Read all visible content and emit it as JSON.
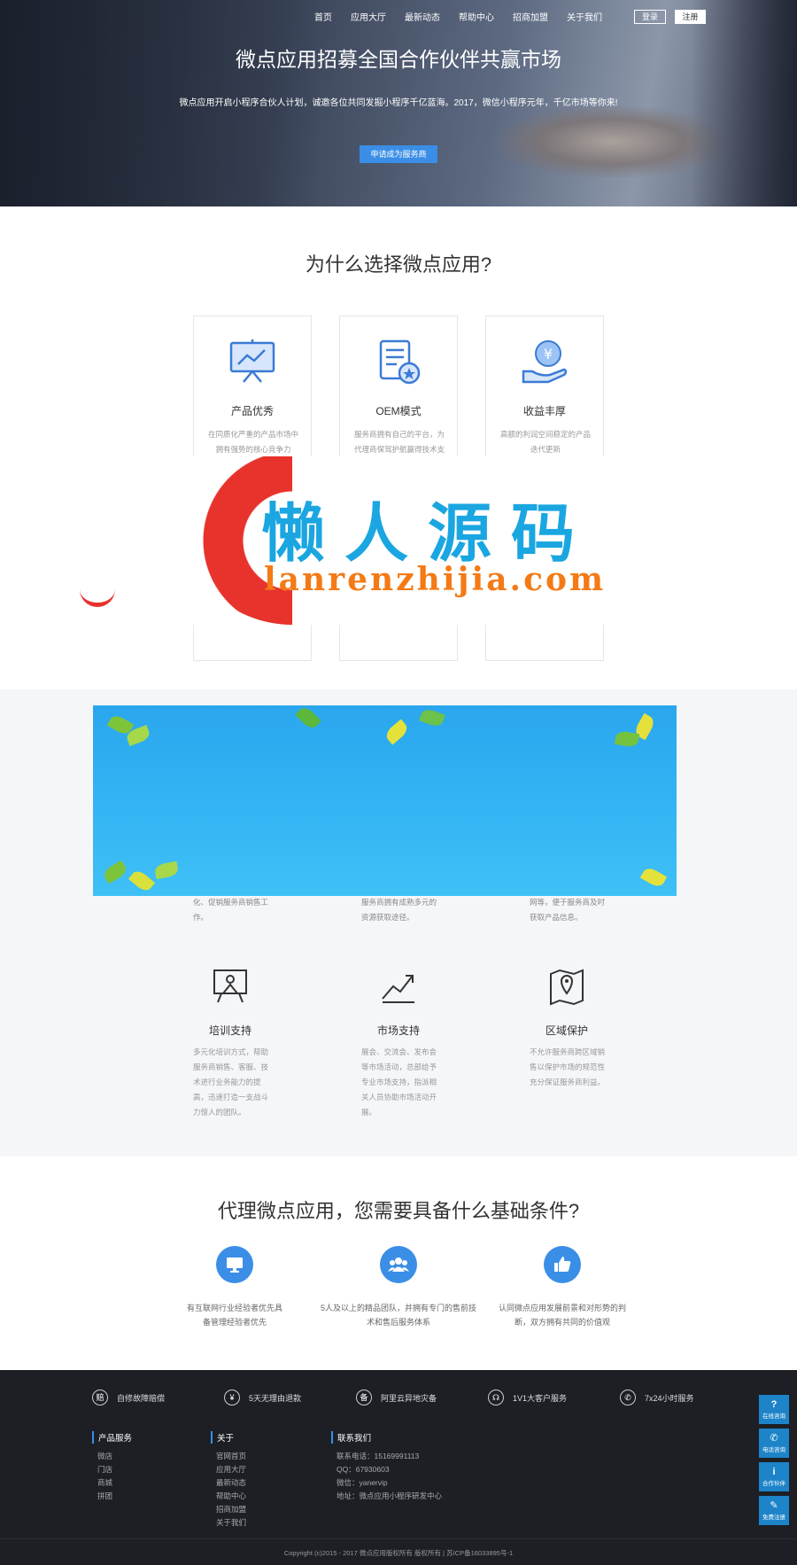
{
  "nav": {
    "items": [
      "首页",
      "应用大厅",
      "最新动态",
      "帮助中心",
      "招商加盟",
      "关于我们"
    ],
    "login": "登录",
    "register": "注册"
  },
  "hero": {
    "title": "微点应用招募全国合作伙伴共赢市场",
    "subtitle": "微点应用开启小程序合伙人计划，诚邀各位共同发掘小程序千亿蓝海。2017，微信小程序元年，千亿市场等你来!",
    "cta": "申请成为服务商"
  },
  "why": {
    "title": "为什么选择微点应用?",
    "cards": [
      {
        "icon": "presentation-chart-icon",
        "title": "产品优秀",
        "desc": "在同质化严重的产品市场中拥有强势的核心竞争力"
      },
      {
        "icon": "document-badge-icon",
        "title": "OEM模式",
        "desc": "服务商拥有自己的平台，为代理商保驾护航赢得技术支撑"
      },
      {
        "icon": "yen-coin-hand-icon",
        "title": "收益丰厚",
        "desc": "高额的利润空间稳定的产品迭代更新"
      }
    ]
  },
  "watermark": {
    "cn": "懒人源码",
    "en": "lanrenzhijia.com"
  },
  "support": {
    "partial_desc": [
      "化、促销服务商销售工作。",
      "服务商拥有成熟多元的资源获取途径。",
      "网等，便于服务商及时获取产品信息。"
    ],
    "items": [
      {
        "icon": "training-board-icon",
        "title": "培训支持",
        "desc": "多元化培训方式，帮助服务商销售、客服、技术进行业务能力的提高，迅速打造一支战斗力惊人的团队。"
      },
      {
        "icon": "market-trend-icon",
        "title": "市场支持",
        "desc": "展会、交流会、发布会等市场活动，总部给予专业市场支持，指派相关人员协助市场活动开展。"
      },
      {
        "icon": "map-pin-icon",
        "title": "区域保护",
        "desc": "不允许服务商跨区域销售以保护市场的规范性充分保证服务商利益。"
      }
    ]
  },
  "cond": {
    "title": "代理微点应用，您需要具备什么基础条件?",
    "items": [
      {
        "icon": "monitor-icon",
        "desc": "有互联网行业经验者优先具备管理经验者优先"
      },
      {
        "icon": "team-icon",
        "desc": "5人及以上的精品团队，并拥有专门的售前技术和售后服务体系"
      },
      {
        "icon": "thumbs-up-icon",
        "desc": "认同微点应用发展前景和对形势的判断，双方拥有共同的价值观"
      }
    ]
  },
  "footer": {
    "features": [
      {
        "glyph": "赔",
        "label": "自修故障赔偿"
      },
      {
        "glyph": "¥",
        "label": "5天无理由退款"
      },
      {
        "glyph": "备",
        "label": "阿里云异地灾备"
      },
      {
        "glyph": "☊",
        "label": "1V1大客户服务"
      },
      {
        "glyph": "✆",
        "label": "7x24小时服务"
      }
    ],
    "products": {
      "title": "产品服务",
      "items": [
        "微店",
        "门店",
        "商城",
        "拼团"
      ]
    },
    "about": {
      "title": "关于",
      "items": [
        "官网首页",
        "应用大厅",
        "最新动态",
        "帮助中心",
        "招商加盟",
        "关于我们"
      ]
    },
    "contact": {
      "title": "联系我们",
      "items": [
        "联系电话：15169991113",
        "QQ：67930603",
        "微信：yanervip",
        "地址：微点应用小程序研发中心"
      ]
    },
    "copyright": "Copyright (c)2015 - 2017 微点应用版权所有 版权所有 | 苏ICP备16033895号-1"
  },
  "side": [
    {
      "glyph": "?",
      "label": "在线咨询"
    },
    {
      "glyph": "✆",
      "label": "电话咨询"
    },
    {
      "glyph": "i",
      "label": "合作伙伴"
    },
    {
      "glyph": "✎",
      "label": "免费注册"
    }
  ]
}
